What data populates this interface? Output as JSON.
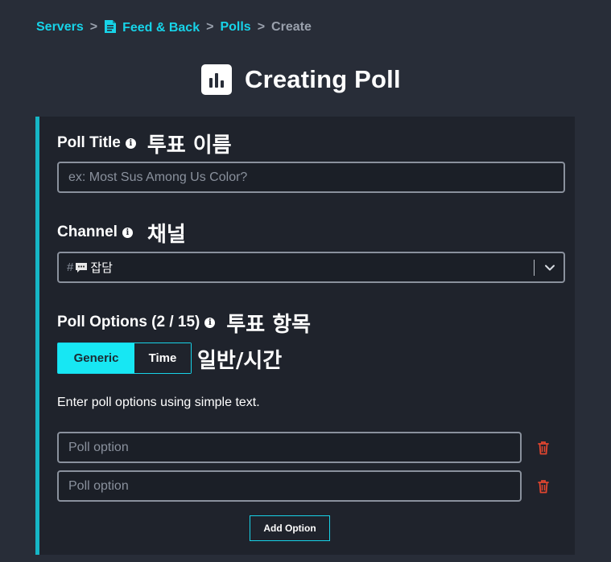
{
  "breadcrumb": {
    "items": [
      "Servers",
      "Feed & Back",
      "Polls"
    ],
    "current": "Create",
    "separator": ">"
  },
  "page": {
    "title": "Creating Poll"
  },
  "poll_title": {
    "label": "Poll Title",
    "note": "투표 이름",
    "placeholder": "ex: Most Sus Among Us Color?",
    "value": ""
  },
  "channel": {
    "label": "Channel",
    "note": "채널",
    "prefix": "#",
    "value": "잡담"
  },
  "poll_options": {
    "label": "Poll Options (2 / 15)",
    "note": "투표 항목",
    "modes": [
      "Generic",
      "Time"
    ],
    "selected_mode": "Generic",
    "modes_note": "일반/시간",
    "help": "Enter poll options using simple text.",
    "option_placeholder": "Poll option",
    "options": [
      "",
      ""
    ],
    "add_label": "Add Option"
  },
  "colors": {
    "accent": "#17d3e8",
    "panel_border": "#16b6c6",
    "background": "#282d38",
    "panel": "#1f232c",
    "danger": "#e0452f"
  }
}
